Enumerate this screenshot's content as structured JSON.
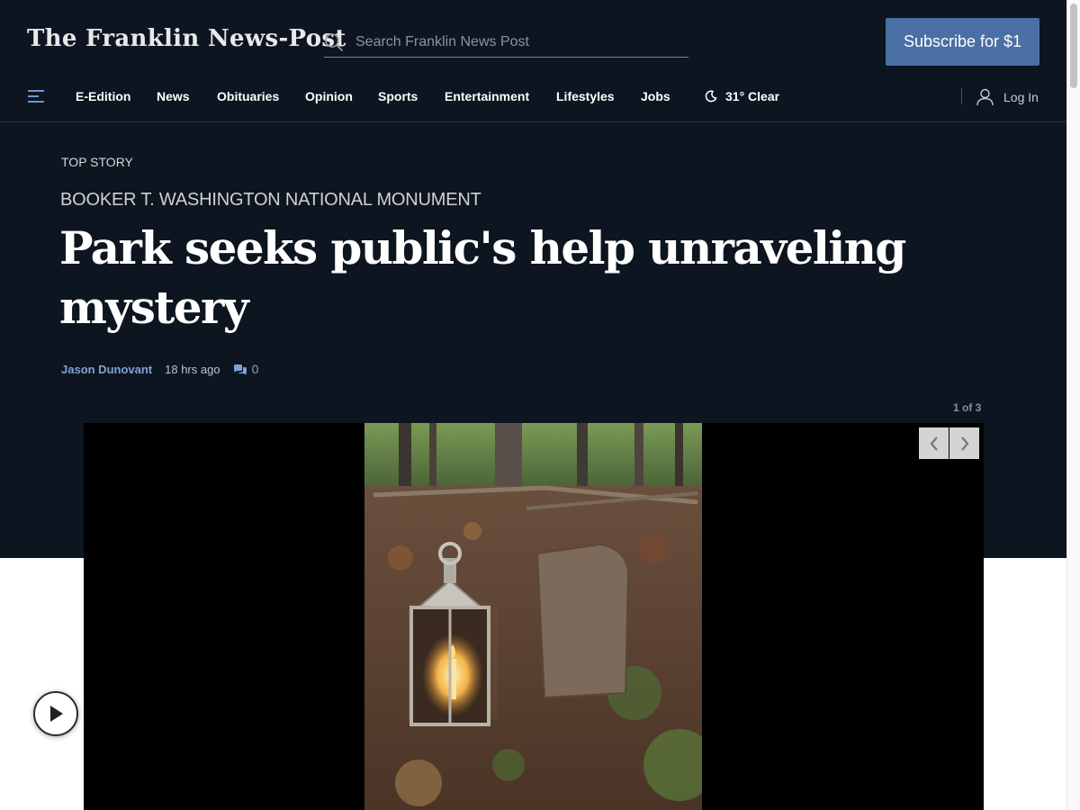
{
  "header": {
    "logo_text": "The Franklin News-Post",
    "search_placeholder": "Search Franklin News Post",
    "subscribe_label": "Subscribe for $1"
  },
  "nav": {
    "items": [
      "E-Edition",
      "News",
      "Obituaries",
      "Opinion",
      "Sports",
      "Entertainment",
      "Lifestyles",
      "Jobs"
    ],
    "weather": "31° Clear",
    "login_label": "Log In"
  },
  "article": {
    "kicker": "TOP STORY",
    "section": "BOOKER T. WASHINGTON NATIONAL MONUMENT",
    "headline": "Park seeks public's help unraveling mystery",
    "author": "Jason Dunovant",
    "time": "18 hrs ago",
    "comment_count": "0"
  },
  "gallery": {
    "counter": "1 of 3"
  },
  "colors": {
    "header_bg": "#0d1520",
    "accent": "#4a6fa5",
    "byline_link": "#7fa3d4"
  }
}
